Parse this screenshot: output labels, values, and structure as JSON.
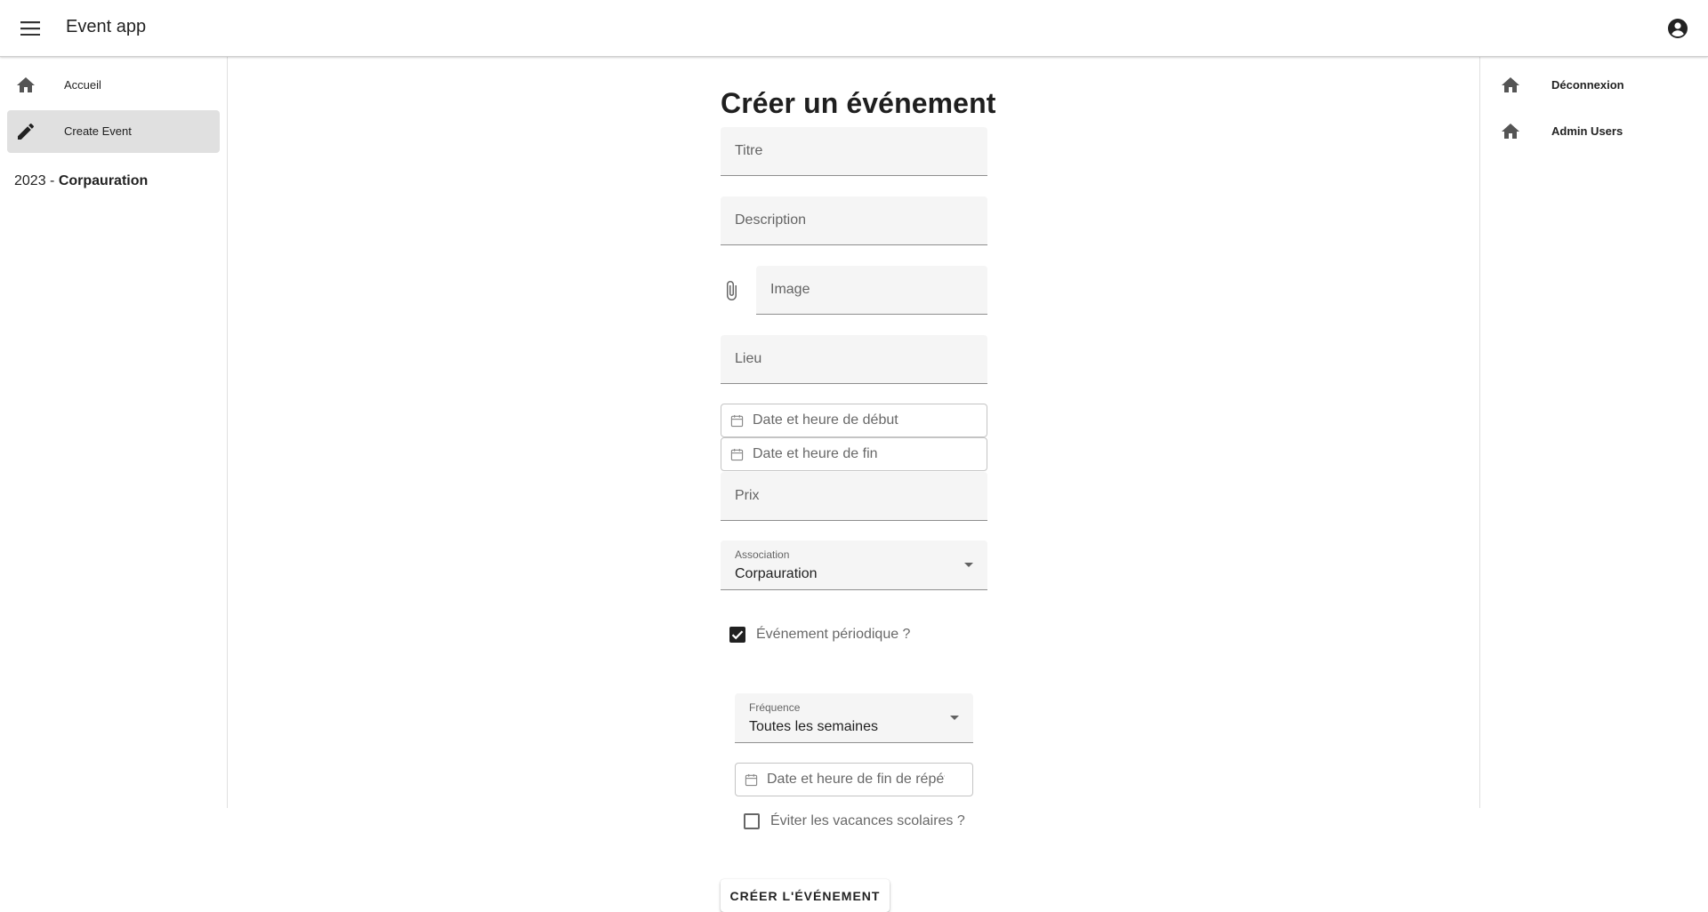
{
  "app": {
    "title": "Event app"
  },
  "icons": {
    "menu": "menu-icon",
    "account": "account-circle-icon",
    "home": "home-icon",
    "edit": "pencil-icon",
    "attach": "paperclip-icon",
    "calendar": "calendar-icon",
    "dropdown": "chevron-down-icon"
  },
  "left_nav": {
    "items": [
      {
        "label": "Accueil",
        "icon": "home-icon",
        "active": false
      },
      {
        "label": "Create Event",
        "icon": "pencil-icon",
        "active": true
      }
    ],
    "year": "2023 - ",
    "organization": "Corpauration"
  },
  "right_nav": {
    "items": [
      {
        "label": "Déconnexion",
        "icon": "home-icon"
      },
      {
        "label": "Admin Users",
        "icon": "home-icon"
      }
    ]
  },
  "form": {
    "title": "Créer un événement",
    "title_field": {
      "placeholder": "Titre",
      "value": ""
    },
    "description_field": {
      "placeholder": "Description",
      "value": ""
    },
    "image_field": {
      "placeholder": "Image",
      "value": ""
    },
    "location_field": {
      "placeholder": "Lieu",
      "value": ""
    },
    "start_date": {
      "placeholder": "Date et heure de début",
      "value": ""
    },
    "end_date": {
      "placeholder": "Date et heure de fin",
      "value": ""
    },
    "price_field": {
      "placeholder": "Prix",
      "value": ""
    },
    "association": {
      "label": "Association",
      "value": "Corpauration"
    },
    "recurring": {
      "label": "Événement périodique ?",
      "checked": true
    },
    "frequency": {
      "label": "Fréquence",
      "value": "Toutes les semaines"
    },
    "repeat_end_date": {
      "placeholder": "Date et heure de fin de répétition",
      "value": ""
    },
    "avoid_holidays": {
      "label": "Éviter les vacances scolaires ?",
      "checked": false
    },
    "submit_label": "CRÉER L'ÉVÉNEMENT"
  },
  "colors": {
    "field_bg": "#f5f5f5",
    "active_nav_bg": "#e0e0e0",
    "checkbox_checked": "#212121"
  }
}
